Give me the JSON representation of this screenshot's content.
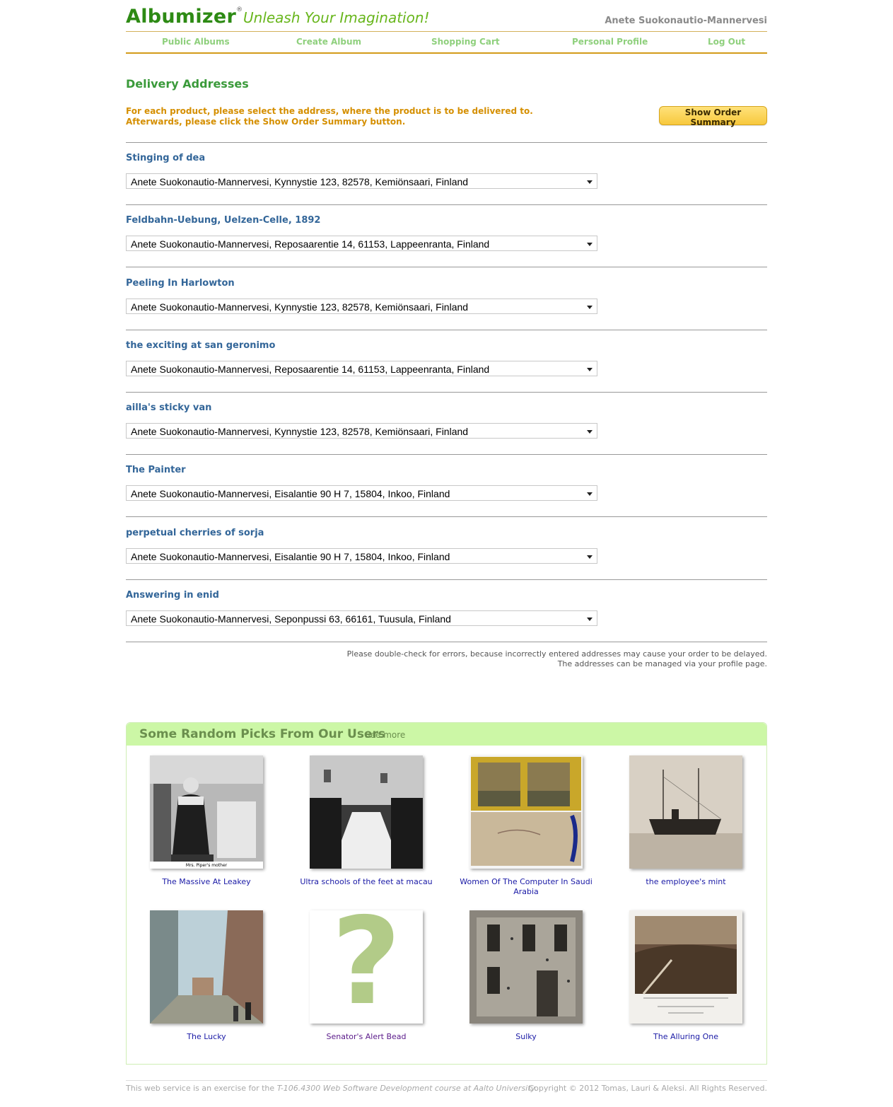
{
  "brand": {
    "logo": "Albumizer",
    "registered": "®",
    "tagline": "Unleash Your Imagination!",
    "username": "Anete Suokonautio-Mannervesi"
  },
  "nav": [
    "Public Albums",
    "Create Album",
    "Shopping Cart",
    "Personal Profile",
    "Log Out"
  ],
  "main": {
    "title": "Delivery Addresses",
    "instruction_line1": "For each product, please select the address, where the product is to be delivered to.",
    "instruction_line2": "Afterwards, please click the Show Order Summary button.",
    "summary_button": "Show Order Summary",
    "products": [
      {
        "name": "Stinging of dea",
        "address": "Anete Suokonautio-Mannervesi, Kynnystie 123, 82578, Kemiönsaari, Finland"
      },
      {
        "name": "Feldbahn-Uebung, Uelzen-Celle, 1892",
        "address": "Anete Suokonautio-Mannervesi, Reposaarentie 14, 61153, Lappeenranta, Finland"
      },
      {
        "name": "Peeling In Harlowton",
        "address": "Anete Suokonautio-Mannervesi, Kynnystie 123, 82578, Kemiönsaari, Finland"
      },
      {
        "name": "the exciting at san geronimo",
        "address": "Anete Suokonautio-Mannervesi, Reposaarentie 14, 61153, Lappeenranta, Finland"
      },
      {
        "name": "ailla's sticky van",
        "address": "Anete Suokonautio-Mannervesi, Kynnystie 123, 82578, Kemiönsaari, Finland"
      },
      {
        "name": "The Painter",
        "address": "Anete Suokonautio-Mannervesi, Eisalantie 90 H 7, 15804, Inkoo, Finland"
      },
      {
        "name": "perpetual cherries of sorja",
        "address": "Anete Suokonautio-Mannervesi, Eisalantie 90 H 7, 15804, Inkoo, Finland"
      },
      {
        "name": "Answering in enid",
        "address": "Anete Suokonautio-Mannervesi, Seponpussi 63, 66161, Tuusula, Finland"
      }
    ],
    "note_line1": "Please double-check for errors, because incorrectly entered addresses may cause your order to be delayed.",
    "note_line2": "The addresses can be managed via your profile page."
  },
  "picks": {
    "title": "Some Random Picks From Our Users",
    "see_more": "See more",
    "items": [
      {
        "caption": "The Massive At Leakey",
        "image_caption": "Mrs. Piper's mother"
      },
      {
        "caption": "Ultra schools of the feet at macau"
      },
      {
        "caption": "Women Of The Computer In Saudi Arabia"
      },
      {
        "caption": "the employee's mint"
      },
      {
        "caption": "The Lucky"
      },
      {
        "caption": "Senator's Alert Bead",
        "placeholder_glyph": "?"
      },
      {
        "caption": "Sulky"
      },
      {
        "caption": "The Alluring One"
      }
    ]
  },
  "footer": {
    "left_prefix": "This web service is an exercise for the ",
    "left_course": "T-106.4300 Web Software Development course at Aalto University.",
    "right": "Copyright © 2012 Tomas, Lauri & Aleksi. All Rights Reserved."
  },
  "colors": {
    "logo": "#2d8a14",
    "tagline": "#68b61c",
    "nav_link": "#8fd07d",
    "instruction": "#d58f00",
    "product_name": "#336699",
    "picks_header": "#ccf7a6",
    "caption_link": "#1a1aa6"
  }
}
